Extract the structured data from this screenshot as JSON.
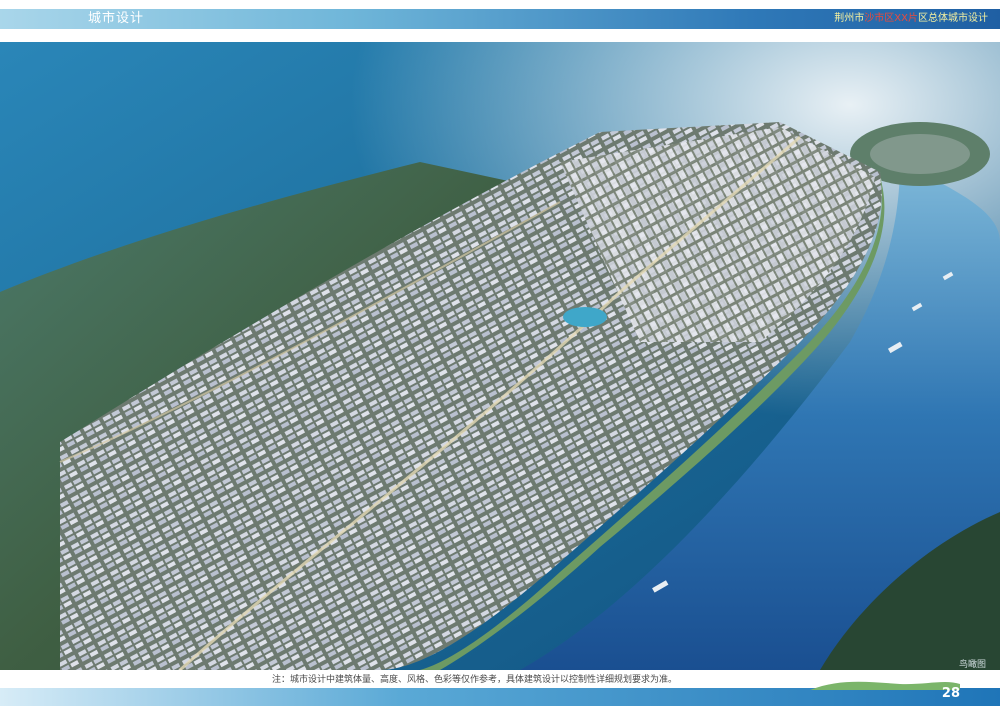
{
  "header": {
    "section_title": "城市设计",
    "right_text_left": "荆州市",
    "right_text_highlight": "沙市区XX片",
    "right_text_right": "区总体城市设计"
  },
  "image": {
    "label": "鸟瞰图"
  },
  "footer": {
    "note": "注：城市设计中建筑体量、高度、风格、色彩等仅作参考，具体建筑设计以控制性详细规划要求为准。",
    "page_number": "28"
  },
  "colors": {
    "header_bar": "#2f79b8",
    "river": "#1f5fa3",
    "land": "#3c5a3a",
    "buildings": "#c8ccd6"
  }
}
